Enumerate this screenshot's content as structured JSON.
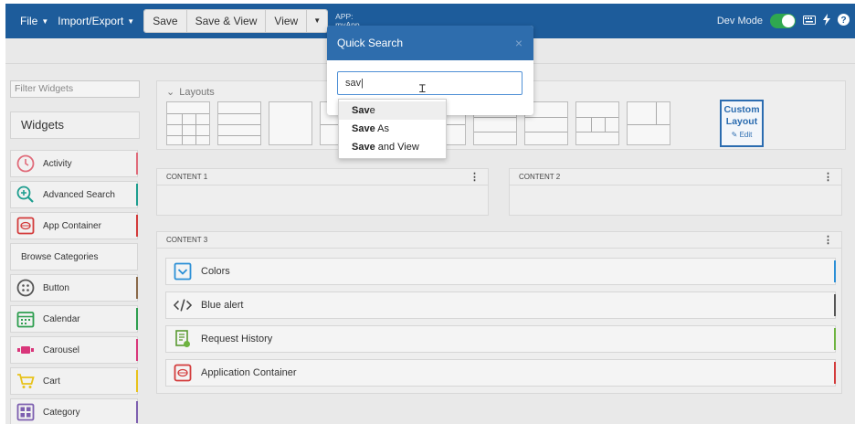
{
  "topbar": {
    "file_label": "File",
    "import_export_label": "Import/Export",
    "save_label": "Save",
    "save_view_label": "Save & View",
    "view_label": "View",
    "app_prefix": "APP:",
    "app_name": "myApp",
    "dev_mode_label": "Dev Mode",
    "dev_mode_on": true,
    "accent": "#1d5c9b"
  },
  "sidebar": {
    "filter_placeholder": "Filter Widgets",
    "header": "Widgets",
    "items": [
      {
        "label": "Activity",
        "icon": "clock-icon",
        "color": "#e06b7a"
      },
      {
        "label": "Advanced Search",
        "icon": "zoom-in-icon",
        "color": "#1e9e8f"
      },
      {
        "label": "App Container",
        "icon": "app-container-icon",
        "color": "#d33b3b"
      },
      {
        "label": "Browse Categories",
        "icon": "",
        "color": ""
      },
      {
        "label": "Button",
        "icon": "button-icon",
        "color": "#8a6a4a"
      },
      {
        "label": "Calendar",
        "icon": "calendar-icon",
        "color": "#2e9e4f"
      },
      {
        "label": "Carousel",
        "icon": "carousel-icon",
        "color": "#d9367a"
      },
      {
        "label": "Cart",
        "icon": "cart-icon",
        "color": "#e8c21a"
      },
      {
        "label": "Category",
        "icon": "category-icon",
        "color": "#7d5fb0"
      }
    ]
  },
  "layouts": {
    "label": "Layouts",
    "custom_line1": "Custom",
    "custom_line2": "Layout",
    "custom_edit": "Edit"
  },
  "contents": {
    "content1": "CONTENT 1",
    "content2": "CONTENT 2",
    "content3": "CONTENT 3",
    "rows": [
      {
        "label": "Colors",
        "icon": "chevron-box-icon",
        "color": "#2b8fd6"
      },
      {
        "label": "Blue alert",
        "icon": "code-icon",
        "color": "#555555"
      },
      {
        "label": "Request History",
        "icon": "document-icon",
        "color": "#6db33f"
      },
      {
        "label": "Application Container",
        "icon": "app-container-icon",
        "color": "#d33b3b"
      }
    ]
  },
  "quick_search": {
    "title": "Quick Search",
    "close": "×",
    "value": "sav",
    "suggestions": [
      {
        "match": "Sav",
        "rest": "e"
      },
      {
        "match": "Save",
        "rest": " As"
      },
      {
        "match": "Save",
        "rest": " and View"
      }
    ]
  }
}
